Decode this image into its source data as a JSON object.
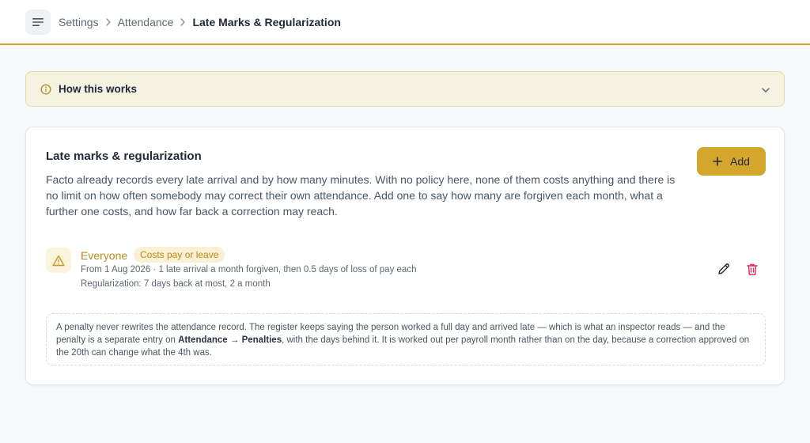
{
  "breadcrumb": [
    "Settings",
    "Attendance",
    "Late Marks & Regularization"
  ],
  "how_it_works": {
    "title": "How this works"
  },
  "section": {
    "title": "Late marks & regularization",
    "description": "Facto already records every late arrival and by how many minutes. With no policy here, none of them costs anything and there is no limit on how often somebody may correct their own attendance. Add one to say how many are forgiven each month, what a further one costs, and how far back a correction may reach.",
    "add_label": "Add"
  },
  "rule": {
    "name": "Everyone",
    "badge": "Costs pay or leave",
    "line1": "From 1 Aug 2026 · 1 late arrival a month forgiven, then 0.5 days of loss of pay each",
    "line2": "Regularization: 7 days back at most, 2 a month"
  },
  "note": {
    "part1": "A penalty never rewrites the attendance record. The register keeps saying the person worked a full day and arrived late — which is what an inspector reads — and the penalty is a separate entry on ",
    "bold": "Attendance → Penalties",
    "part2": ", with the days behind it. It is worked out per payroll month rather than on the day, because a correction approved on the 20th can change what the 4th was."
  },
  "icons": {
    "menu": "menu-icon",
    "chevron_right": "chevron-right-icon",
    "info": "info-icon",
    "chevron_down": "chevron-down-icon",
    "plus": "plus-icon",
    "warning": "warning-icon",
    "edit": "pencil-icon",
    "delete": "trash-icon"
  },
  "colors": {
    "accent": "#d4a72c",
    "rule_name": "#b8891a",
    "delete": "#e0245e",
    "info_bg": "#f6f2e2"
  }
}
